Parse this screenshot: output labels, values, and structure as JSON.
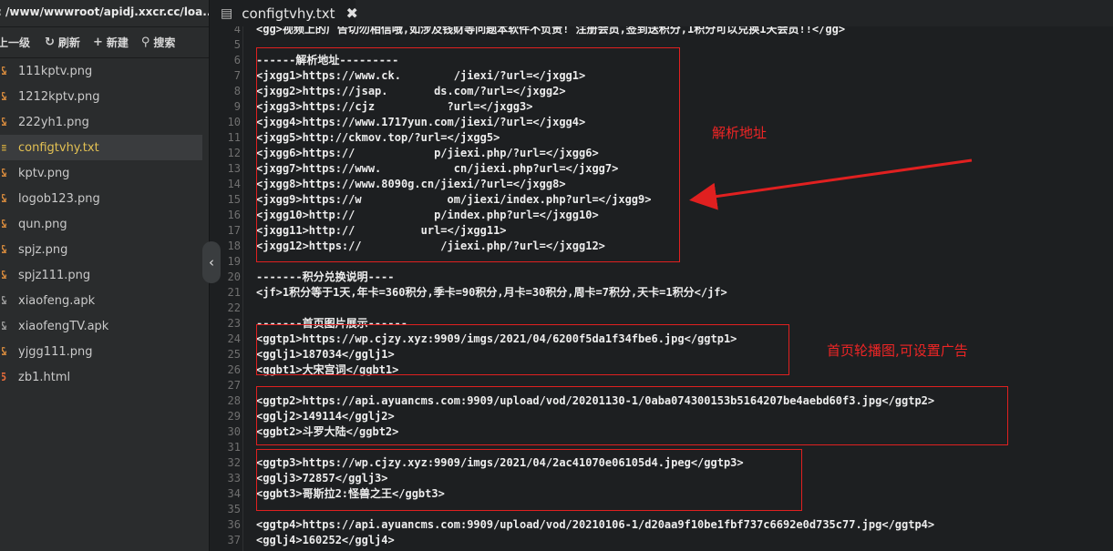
{
  "sidebar": {
    "path": ": /www/wwwroot/apidj.xxcr.cc/loa...",
    "toolbar": [
      {
        "icon": "up-icon",
        "glyph": "",
        "label": "上一级"
      },
      {
        "icon": "refresh-icon",
        "glyph": "↻",
        "label": "刷新"
      },
      {
        "icon": "plus-icon",
        "glyph": "+",
        "label": "新建"
      },
      {
        "icon": "search-icon",
        "glyph": "⚲",
        "label": "搜索"
      }
    ],
    "files": [
      {
        "name": "111kptv.png",
        "type": "png",
        "glyph": "&"
      },
      {
        "name": "1212kptv.png",
        "type": "png",
        "glyph": "&"
      },
      {
        "name": "222yh1.png",
        "type": "png",
        "glyph": "&"
      },
      {
        "name": "configtvhy.txt",
        "type": "txt",
        "glyph": "≡",
        "active": true
      },
      {
        "name": "kptv.png",
        "type": "png",
        "glyph": "&"
      },
      {
        "name": "logob123.png",
        "type": "png",
        "glyph": "&"
      },
      {
        "name": "qun.png",
        "type": "png",
        "glyph": "&"
      },
      {
        "name": "spjz.png",
        "type": "png",
        "glyph": "&"
      },
      {
        "name": "spjz111.png",
        "type": "png",
        "glyph": "&"
      },
      {
        "name": "xiaofeng.apk",
        "type": "apk",
        "glyph": "&"
      },
      {
        "name": "xiaofengTV.apk",
        "type": "apk",
        "glyph": "&"
      },
      {
        "name": "yjgg111.png",
        "type": "png",
        "glyph": "&"
      },
      {
        "name": "zb1.html",
        "type": "html",
        "glyph": "5"
      }
    ],
    "collapse_glyph": "‹"
  },
  "editor": {
    "tab_title": "configtvhy.txt",
    "close_glyph": "✖",
    "lines": [
      {
        "n": "4",
        "text": "<gg>视频上的广告切勿相信哦,如涉及钱财等问题本软件不负责! 注册会员,签到送积分,1积分可以兑换1天会员!!</gg>"
      },
      {
        "n": "5",
        "text": ""
      },
      {
        "n": "6",
        "text": "------解析地址---------"
      },
      {
        "n": "7",
        "text": "<jxgg1>https://www.ck.        /jiexi/?url=</jxgg1>"
      },
      {
        "n": "8",
        "text": "<jxgg2>https://jsap.       ds.com/?url=</jxgg2>"
      },
      {
        "n": "9",
        "text": "<jxgg3>https://cjz           ?url=</jxgg3>"
      },
      {
        "n": "10",
        "text": "<jxgg4>https://www.1717yun.com/jiexi/?url=</jxgg4>"
      },
      {
        "n": "11",
        "text": "<jxgg5>http://ckmov.top/?url=</jxgg5>"
      },
      {
        "n": "12",
        "text": "<jxgg6>https://            p/jiexi.php/?url=</jxgg6>"
      },
      {
        "n": "13",
        "text": "<jxgg7>https://www.           cn/jiexi.php?url=</jxgg7>"
      },
      {
        "n": "14",
        "text": "<jxgg8>https://www.8090g.cn/jiexi/?url=</jxgg8>"
      },
      {
        "n": "15",
        "text": "<jxgg9>https://w             om/jiexi/index.php?url=</jxgg9>"
      },
      {
        "n": "16",
        "text": "<jxgg10>http://            p/index.php?url=</jxgg10>"
      },
      {
        "n": "17",
        "text": "<jxgg11>http://          url=</jxgg11>"
      },
      {
        "n": "18",
        "text": "<jxgg12>https://            /jiexi.php/?url=</jxgg12>"
      },
      {
        "n": "19",
        "text": ""
      },
      {
        "n": "20",
        "text": "-------积分兑换说明----"
      },
      {
        "n": "21",
        "text": "<jf>1积分等于1天,年卡=360积分,季卡=90积分,月卡=30积分,周卡=7积分,天卡=1积分</jf>"
      },
      {
        "n": "22",
        "text": ""
      },
      {
        "n": "23",
        "text": "-------首页图片展示------"
      },
      {
        "n": "24",
        "text": "<ggtp1>https://wp.cjzy.xyz:9909/imgs/2021/04/6200f5da1f34fbe6.jpg</ggtp1>"
      },
      {
        "n": "25",
        "text": "<gglj1>187034</gglj1>"
      },
      {
        "n": "26",
        "text": "<ggbt1>大宋宫词</ggbt1>"
      },
      {
        "n": "27",
        "text": ""
      },
      {
        "n": "28",
        "text": "<ggtp2>https://api.ayuancms.com:9909/upload/vod/20201130-1/0aba074300153b5164207be4aebd60f3.jpg</ggtp2>"
      },
      {
        "n": "29",
        "text": "<gglj2>149114</gglj2>"
      },
      {
        "n": "30",
        "text": "<ggbt2>斗罗大陆</ggbt2>"
      },
      {
        "n": "31",
        "text": ""
      },
      {
        "n": "32",
        "text": "<ggtp3>https://wp.cjzy.xyz:9909/imgs/2021/04/2ac41070e06105d4.jpeg</ggtp3>"
      },
      {
        "n": "33",
        "text": "<gglj3>72857</gglj3>"
      },
      {
        "n": "34",
        "text": "<ggbt3>哥斯拉2:怪兽之王</ggbt3>"
      },
      {
        "n": "35",
        "text": ""
      },
      {
        "n": "36",
        "text": "<ggtp4>https://api.ayuancms.com:9909/upload/vod/20210106-1/d20aa9f10be1fbf737c6692e0d735c77.jpg</ggtp4>"
      },
      {
        "n": "37",
        "text": "<gglj4>160252</gglj4>"
      }
    ]
  },
  "annotations": {
    "parse_label": "解析地址",
    "carousel_label": "首页轮播图,可设置广告",
    "color": "#e02020"
  }
}
